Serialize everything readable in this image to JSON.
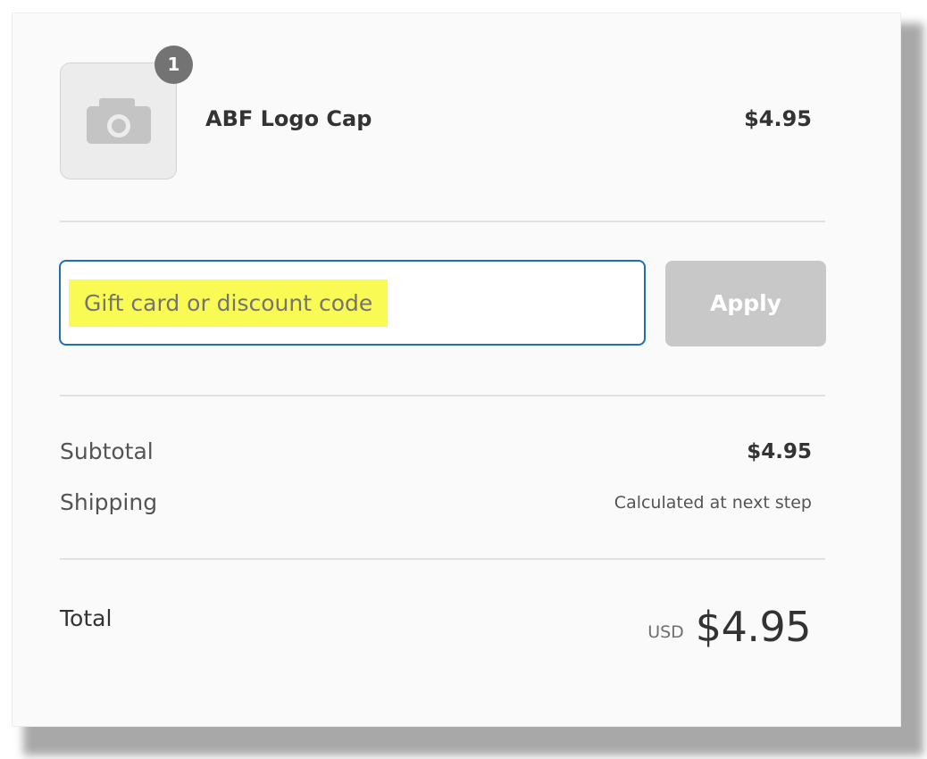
{
  "cart": {
    "item": {
      "quantity": "1",
      "name": "ABF Logo Cap",
      "price": "$4.95",
      "image_icon": "camera-icon"
    }
  },
  "discount": {
    "placeholder": "Gift card or discount code",
    "apply_label": "Apply"
  },
  "summary": {
    "subtotal_label": "Subtotal",
    "subtotal_value": "$4.95",
    "shipping_label": "Shipping",
    "shipping_value": "Calculated at next step",
    "total_label": "Total",
    "total_currency": "USD",
    "total_value": "$4.95"
  },
  "colors": {
    "input_border": "#1f6fb5",
    "highlight": "#fafa55",
    "button_disabled": "#c8c8c8",
    "badge": "#737373"
  }
}
